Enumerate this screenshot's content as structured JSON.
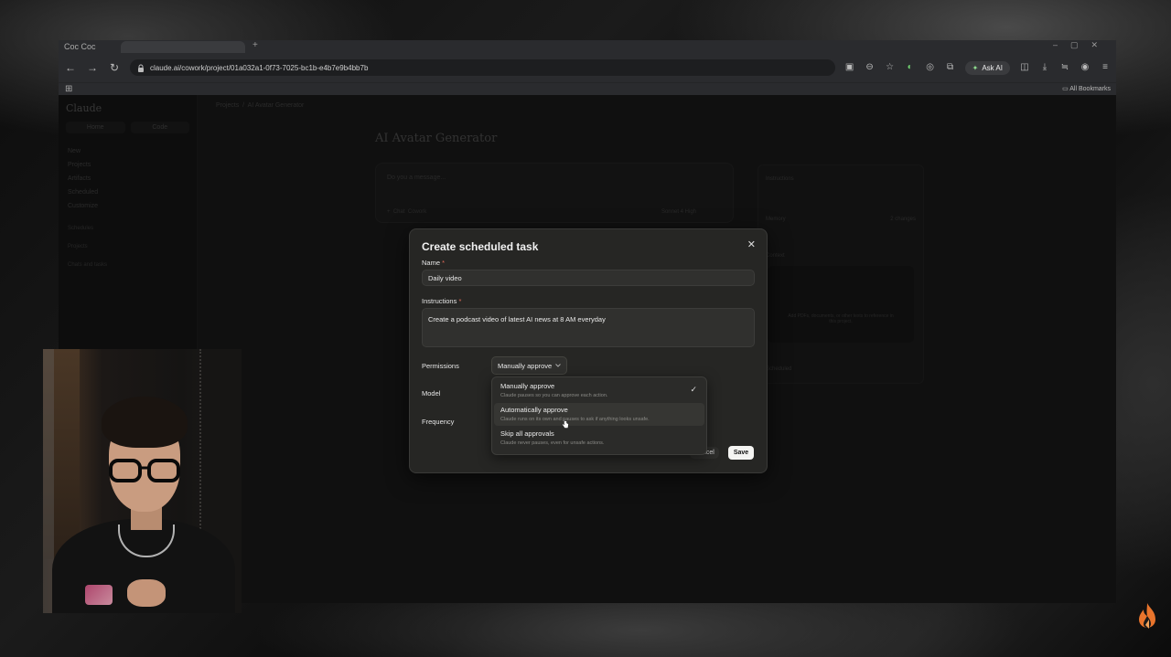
{
  "browser": {
    "brand": "Coc Coc",
    "url": "claude.ai/cowork/project/01a032a1-0f73-7025-bc1b-e4b7e9b4bb7b",
    "ask_ai": "Ask AI",
    "all_bookmarks": "All Bookmarks"
  },
  "sidebar": {
    "title": "Claude",
    "tabs": [
      "Home",
      "Code"
    ],
    "items": [
      "New",
      "Projects",
      "Artifacts",
      "Scheduled",
      "Customize"
    ],
    "sections": [
      "Schedules",
      "Projects",
      "Chats and tasks"
    ]
  },
  "breadcrumb": {
    "root": "Projects",
    "current": "AI Avatar Generator"
  },
  "project": {
    "title": "AI Avatar Generator",
    "composer_placeholder": "Do you a message...",
    "chips": [
      "Chat",
      "Cowork"
    ],
    "model": "Sonnet 4  High"
  },
  "right_panel": {
    "instructions": "Instructions",
    "memory": "Memory",
    "memory_badge": "2 changes",
    "context": "Context",
    "context_hint": "Add PDFs, documents, or other texts to reference in this project.",
    "scheduled": "Scheduled"
  },
  "modal": {
    "title": "Create scheduled task",
    "name_label": "Name",
    "name_value": "Daily video",
    "instructions_label": "Instructions",
    "instructions_value": "Create a podcast video of latest AI news at 8 AM everyday",
    "permissions_label": "Permissions",
    "permissions_value": "Manually approve",
    "model_label": "Model",
    "frequency_label": "Frequency",
    "permission_options": [
      {
        "title": "Manually approve",
        "desc": "Claude pauses so you can approve each action."
      },
      {
        "title": "Automatically approve",
        "desc": "Claude runs on its own and pauses to ask if anything looks unsafe."
      },
      {
        "title": "Skip all approvals",
        "desc": "Claude never pauses, even for unsafe actions."
      }
    ],
    "cancel": "Cancel",
    "save": "Save"
  },
  "colors": {
    "accent_required": "#e06c5a",
    "modal_bg": "#262624",
    "save_bg": "#f4f4f2"
  },
  "icons": [
    "back-icon",
    "forward-icon",
    "reload-icon",
    "site-info-icon",
    "star-icon",
    "extensions-icon",
    "download-icon",
    "menu-icon",
    "close-icon",
    "check-icon",
    "chevron-down-icon",
    "cursor-icon"
  ]
}
